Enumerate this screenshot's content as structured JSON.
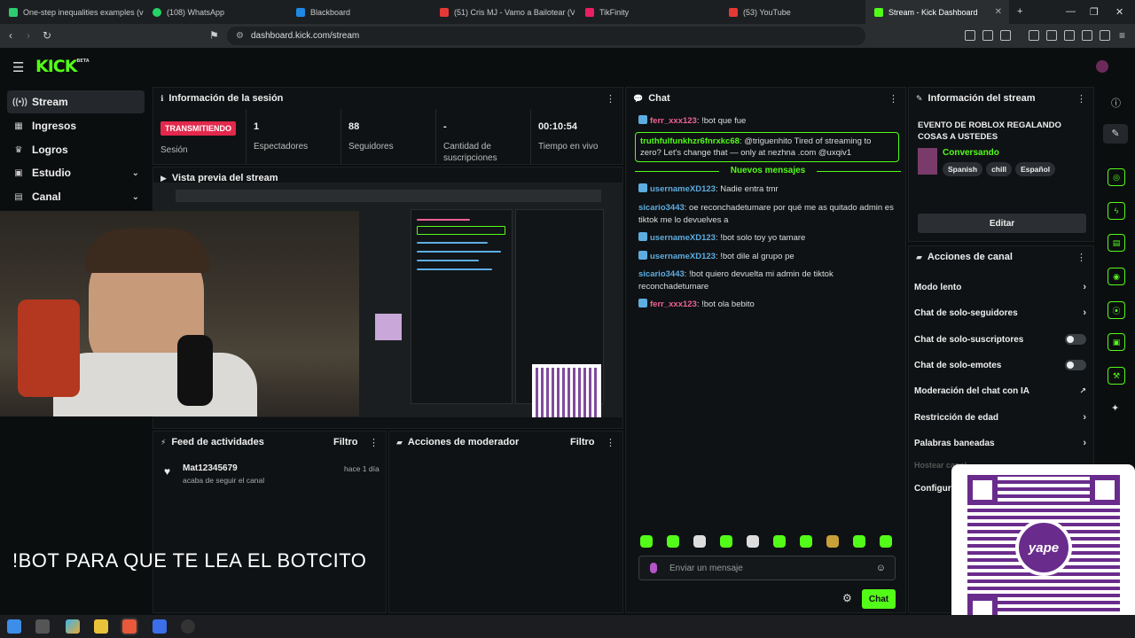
{
  "browser": {
    "tabs": [
      {
        "label": "One-step inequalities examples (vide",
        "color": "#2ecc71"
      },
      {
        "label": "(108) WhatsApp",
        "color": "#25d366"
      },
      {
        "label": "Blackboard",
        "color": "#1e88e5"
      },
      {
        "label": "(51) Cris MJ - Vamo a Bailotear (Visu",
        "color": "#e53935"
      },
      {
        "label": "TikFinity",
        "color": "#e91e63"
      },
      {
        "label": "(53) YouTube",
        "color": "#e53935"
      },
      {
        "label": "Stream - Kick Dashboard",
        "color": "#53fc18"
      }
    ],
    "url": "dashboard.kick.com/stream"
  },
  "header": {
    "logo": "KICK",
    "logo_tag": "BETA"
  },
  "sidebar": {
    "items": [
      {
        "label": "Stream",
        "icon": "broadcast-icon"
      },
      {
        "label": "Ingresos",
        "icon": "money-icon"
      },
      {
        "label": "Logros",
        "icon": "trophy-icon"
      },
      {
        "label": "Estudio",
        "icon": "studio-icon"
      },
      {
        "label": "Canal",
        "icon": "channel-icon"
      }
    ]
  },
  "session": {
    "title": "Información de la sesión",
    "live_badge": "TRANSMITIENDO",
    "session_label": "Sesión",
    "stats": [
      {
        "value": "1",
        "label": "Espectadores"
      },
      {
        "value": "88",
        "label": "Seguidores"
      },
      {
        "value": "-",
        "label": "Cantidad de suscripciones"
      },
      {
        "value": "00:10:54",
        "label": "Tiempo en vivo"
      }
    ]
  },
  "preview": {
    "title": "Vista previa del stream"
  },
  "feed": {
    "title": "Feed de actividades",
    "filter": "Filtro",
    "items": [
      {
        "user": "Mat12345679",
        "text": "acaba de seguir el canal",
        "time": "hace 1 día"
      }
    ]
  },
  "mod": {
    "title": "Acciones de moderador",
    "filter": "Filtro"
  },
  "chat": {
    "title": "Chat",
    "top_message": {
      "user": "ferr_xxx123",
      "text": "!bot que fue",
      "color": "#f06292"
    },
    "pinned": {
      "user": "truthfulfunkhzr6fnrxkc68",
      "text": "@triguenhito Tired of streaming to zero? Let's change that — only at nezhna .com @uxqiv1"
    },
    "new_messages": "Nuevos mensajes",
    "messages": [
      {
        "user": "usernameXD123",
        "text": "Nadie entra tmr",
        "color": "#5dade2",
        "badge": true
      },
      {
        "user": "sicario3443",
        "text": "oe reconchadetumare por qué me as quitado admin es tiktok me lo devuelves a",
        "color": "#5dade2",
        "badge": false
      },
      {
        "user": "usernameXD123",
        "text": "!bot solo toy yo tamare",
        "color": "#5dade2",
        "badge": true
      },
      {
        "user": "usernameXD123",
        "text": "!bot dile al grupo pe",
        "color": "#5dade2",
        "badge": true
      },
      {
        "user": "sicario3443",
        "text": "!bot quiero devuelta mi admin de tiktok reconchadetumare",
        "color": "#5dade2",
        "badge": false
      },
      {
        "user": "ferr_xxx123",
        "text": "!bot ola bebito",
        "color": "#f06292",
        "badge": true
      }
    ],
    "input_placeholder": "Enviar un mensaje",
    "send_label": "Chat"
  },
  "stream_info": {
    "title": "Información del stream",
    "stream_title": "EVENTO DE ROBLOX REGALANDO COSAS A USTEDES",
    "category": "Conversando",
    "tags": [
      "Spanish",
      "chill",
      "Español"
    ],
    "edit_label": "Editar"
  },
  "channel_actions": {
    "title": "Acciones de canal",
    "items": [
      {
        "label": "Modo lento",
        "control": "chevron"
      },
      {
        "label": "Chat de solo-seguidores",
        "control": "chevron"
      },
      {
        "label": "Chat de solo-suscriptores",
        "control": "toggle"
      },
      {
        "label": "Chat de solo-emotes",
        "control": "toggle"
      },
      {
        "label": "Moderación del chat con IA",
        "control": "external"
      },
      {
        "label": "Restricción de edad",
        "control": "chevron"
      },
      {
        "label": "Palabras baneadas",
        "control": "chevron"
      },
      {
        "label": "Hostear canal",
        "control": "none"
      },
      {
        "label": "Configura",
        "control": "none"
      }
    ]
  },
  "overlay": {
    "subtitle": "!BOT PARA QUE TE LEA EL BOTCITO",
    "qr_brand": "yape"
  }
}
